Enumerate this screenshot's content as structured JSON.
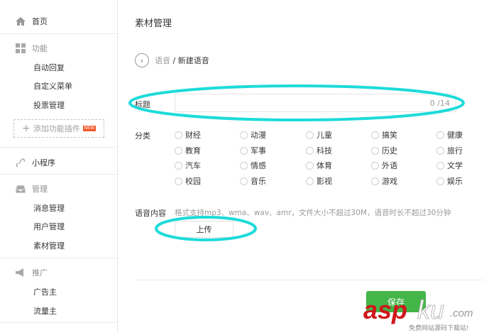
{
  "sidebar": {
    "home": "首页",
    "features": {
      "label": "功能",
      "items": [
        "自动回复",
        "自定义菜单",
        "投票管理"
      ],
      "add_plugin": "添加功能插件",
      "new_badge": "NEW"
    },
    "miniprogram": "小程序",
    "manage": {
      "label": "管理",
      "items": [
        "消息管理",
        "用户管理",
        "素材管理"
      ]
    },
    "promote": {
      "label": "推广",
      "items": [
        "广告主",
        "流量主"
      ]
    }
  },
  "main": {
    "title": "素材管理",
    "breadcrumb": {
      "parent": "语音",
      "separator": "/",
      "current": "新建语音"
    },
    "title_field": {
      "label": "标题",
      "value": "",
      "counter": "0 /14"
    },
    "category": {
      "label": "分类",
      "options": [
        "财经",
        "动漫",
        "儿童",
        "搞笑",
        "健康",
        "教育",
        "军事",
        "科技",
        "历史",
        "旅行",
        "汽车",
        "情感",
        "体育",
        "外语",
        "文学",
        "校园",
        "音乐",
        "影视",
        "游戏",
        "娱乐"
      ]
    },
    "voice": {
      "label": "语音内容",
      "hint": "格式支持mp3、wma、wav、amr，文件大小不超过30M，语音时长不超过30分钟",
      "upload": "上传"
    },
    "save": "保存"
  },
  "watermark": {
    "brand": "aspku",
    "domain": ".com",
    "slogan": "免费网站源码下载站!"
  },
  "colors": {
    "accent_green": "#44b549",
    "annotation": "#1ddbd9",
    "watermark_red": "#d0161b"
  }
}
